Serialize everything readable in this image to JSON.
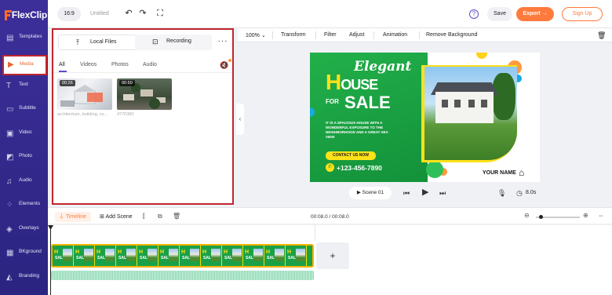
{
  "app": {
    "logo_text": "FlexClip"
  },
  "sidebar": {
    "items": [
      {
        "label": "Templates",
        "icon": "templates-icon"
      },
      {
        "label": "Media",
        "icon": "media-icon",
        "active": true
      },
      {
        "label": "Text",
        "icon": "text-icon"
      },
      {
        "label": "Subtitle",
        "icon": "subtitle-icon"
      },
      {
        "label": "Video",
        "icon": "video-icon"
      },
      {
        "label": "Photo",
        "icon": "photo-icon"
      },
      {
        "label": "Audio",
        "icon": "audio-icon"
      },
      {
        "label": "Elements",
        "icon": "elements-icon"
      },
      {
        "label": "Overlays",
        "icon": "overlays-icon"
      },
      {
        "label": "BKground",
        "icon": "background-icon"
      },
      {
        "label": "Branding",
        "icon": "branding-icon"
      }
    ]
  },
  "topbar": {
    "aspect_ratio": "16:9",
    "project_title": "Untitled",
    "save_label": "Save",
    "export_label": "Export →",
    "signup_label": "Sign Up",
    "help_glyph": "?"
  },
  "media_panel": {
    "local_files_label": "Local Files",
    "recording_label": "Recording",
    "more_label": "···",
    "tabs": [
      "All",
      "Videos",
      "Photos",
      "Audio"
    ],
    "active_tab": "All",
    "items": [
      {
        "duration": "00:26",
        "caption": "architecture, building, co..."
      },
      {
        "duration": "00:50",
        "caption": "4770380"
      }
    ]
  },
  "editor_toolbar": {
    "zoom": "100%",
    "items": [
      "Transform",
      "Filter",
      "Adjust",
      "Animation",
      "Remove Background"
    ]
  },
  "canvas": {
    "headline_elegant": "Elegant",
    "headline_house_h": "H",
    "headline_house_rest": "OUSE",
    "headline_for": "FOR",
    "headline_sale": "SALE",
    "body_copy": "IT IS A SPACIOUS HOUSE WITH A WONDERFUL EXPOSURE TO THE NEIGHBORHOOD AND A GREAT SEA VIEW",
    "contact_label": "CONTACT US NOW",
    "phone": "+123-456-7890",
    "your_name": "YOUR NAME",
    "colors": {
      "green": "#13913a",
      "yellow": "#ffe11a",
      "orange": "#ff9a3c"
    }
  },
  "playback": {
    "scene_label": "Scene 01",
    "duration": "8.0s"
  },
  "timeline": {
    "tab_label": "Timeline",
    "add_scene_label": "Add Scene",
    "time_readout": "00:08.0 / 00:08.0",
    "add_clip_glyph": "+",
    "frame_count": 12
  }
}
